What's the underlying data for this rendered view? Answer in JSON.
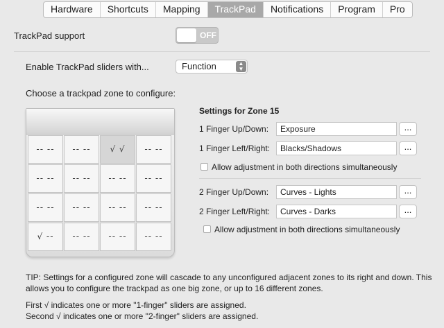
{
  "tabs": [
    {
      "label": "Hardware",
      "active": false
    },
    {
      "label": "Shortcuts",
      "active": false
    },
    {
      "label": "Mapping",
      "active": false
    },
    {
      "label": "TrackPad",
      "active": true
    },
    {
      "label": "Notifications",
      "active": false
    },
    {
      "label": "Program",
      "active": false
    },
    {
      "label": "Pro",
      "active": false
    }
  ],
  "trackpad_support": {
    "label": "TrackPad support",
    "toggle_text": "OFF",
    "on": false
  },
  "enable_sliders": {
    "label": "Enable TrackPad sliders with...",
    "selected": "Function"
  },
  "zone_prompt": "Choose a trackpad zone to configure:",
  "zones": [
    [
      "-- --",
      "-- --",
      "√ √",
      "-- --"
    ],
    [
      "-- --",
      "-- --",
      "-- --",
      "-- --"
    ],
    [
      "-- --",
      "-- --",
      "-- --",
      "-- --"
    ],
    [
      "√ --",
      "-- --",
      "-- --",
      "-- --"
    ]
  ],
  "settings": {
    "heading": "Settings for Zone 15",
    "one_up_down": {
      "label": "1 Finger Up/Down:",
      "value": "Exposure",
      "button": "..."
    },
    "one_left_right": {
      "label": "1 Finger Left/Right:",
      "value": "Blacks/Shadows",
      "button": "..."
    },
    "one_both": "Allow adjustment in both directions simultaneously",
    "two_up_down": {
      "label": "2 Finger Up/Down:",
      "value": "Curves - Lights",
      "button": "..."
    },
    "two_left_right": {
      "label": "2 Finger Left/Right:",
      "value": "Curves - Darks",
      "button": "..."
    },
    "two_both": "Allow adjustment in both directions simultaneously"
  },
  "tip": {
    "line1": "TIP: Settings for a configured zone will cascade to any unconfigured adjacent zones to its right and down. This",
    "line2": "allows you to configure the trackpad as one big zone, or up to 16 different zones.",
    "line3": "First √ indicates one or more \"1-finger\" sliders are assigned.",
    "line4": "Second √ indicates one or more \"2-finger\" sliders are assigned."
  }
}
